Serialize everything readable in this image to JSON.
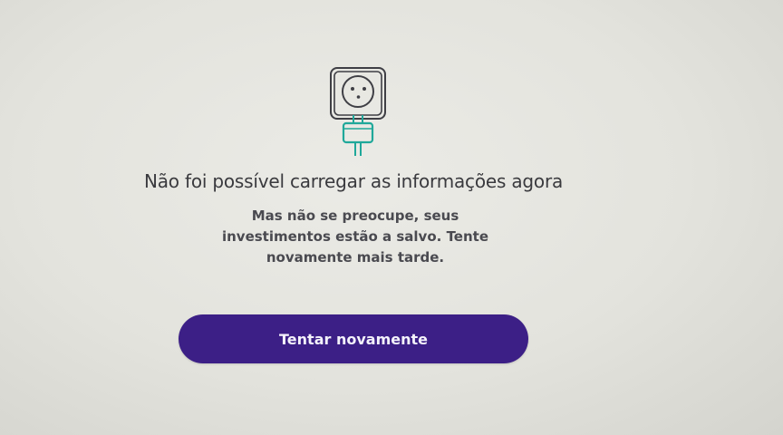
{
  "error": {
    "title": "Não foi possível carregar as informações agora",
    "message": "Mas não se preocupe, seus investimentos estão a salvo. Tente novamente mais tarde."
  },
  "actions": {
    "retry_label": "Tentar novamente"
  },
  "icons": {
    "illustration": "unplugged-socket-icon"
  },
  "colors": {
    "button_bg": "#3c1f86",
    "illustration_accent": "#1fa89a",
    "text": "#3a3a3e"
  }
}
